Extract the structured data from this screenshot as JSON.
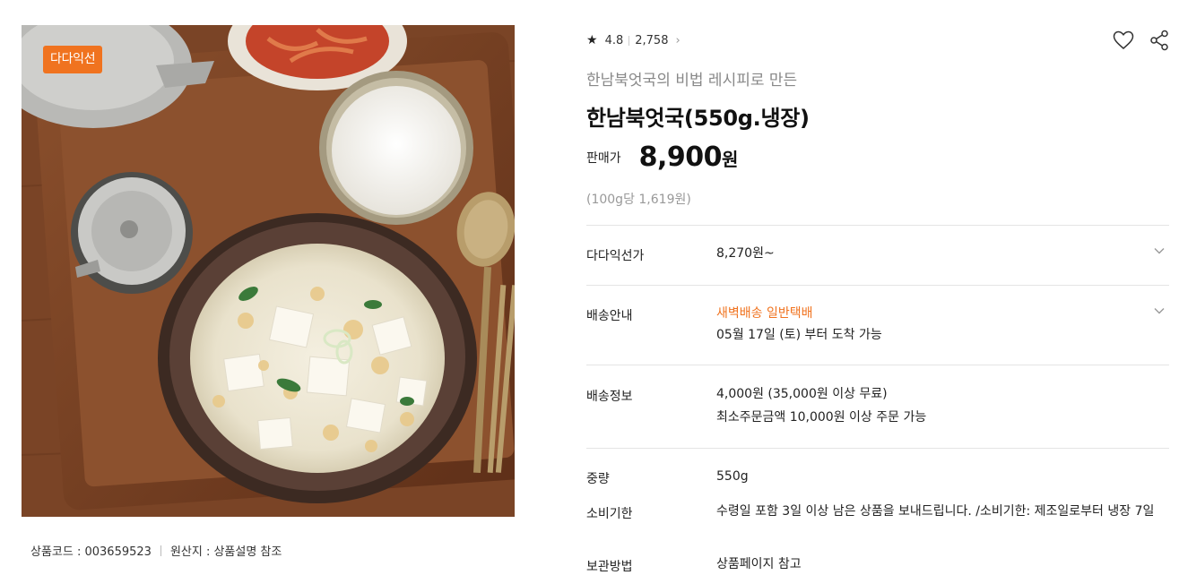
{
  "image": {
    "badge": "다다익선",
    "alt_icon": "product-photo"
  },
  "meta": {
    "product_code": "상품코드 : 003659523",
    "origin": "원산지 : 상품설명 참조"
  },
  "rating": {
    "score": "4.8",
    "count": "2,758"
  },
  "product": {
    "subtitle": "한남북엇국의 비법 레시피로 만든",
    "title": "한남북엇국(550g.냉장)",
    "price_label": "판매가",
    "price": "8,900",
    "price_unit": "원",
    "unit_price": "(100g당 1,619원)"
  },
  "rows": {
    "bulk": {
      "label": "다다익선가",
      "value": "8,270원~"
    },
    "delivery_guide": {
      "label": "배송안내",
      "options": "새벽배송 일반택배",
      "arrival": "05월 17일 (토) 부터 도착 가능"
    },
    "shipping_info": {
      "label": "배송정보",
      "fee": "4,000원 (35,000원 이상 무료)",
      "min_order": "최소주문금액 10,000원 이상 주문 가능"
    },
    "weight": {
      "label": "중량",
      "value": "550g"
    },
    "expiry": {
      "label": "소비기한",
      "value": "수령일 포함 3일 이상 남은 상품을 보내드립니다. /소비기한: 제조일로부터 냉장 7일"
    },
    "storage": {
      "label": "보관방법",
      "value": "상품페이지 참고"
    }
  },
  "colors": {
    "accent": "#f0731f",
    "text": "#111111",
    "muted": "#999999",
    "divider": "#e4e4e4"
  },
  "icons": [
    "star-icon",
    "chevron-right-icon",
    "heart-icon",
    "share-icon",
    "chevron-down-icon"
  ]
}
